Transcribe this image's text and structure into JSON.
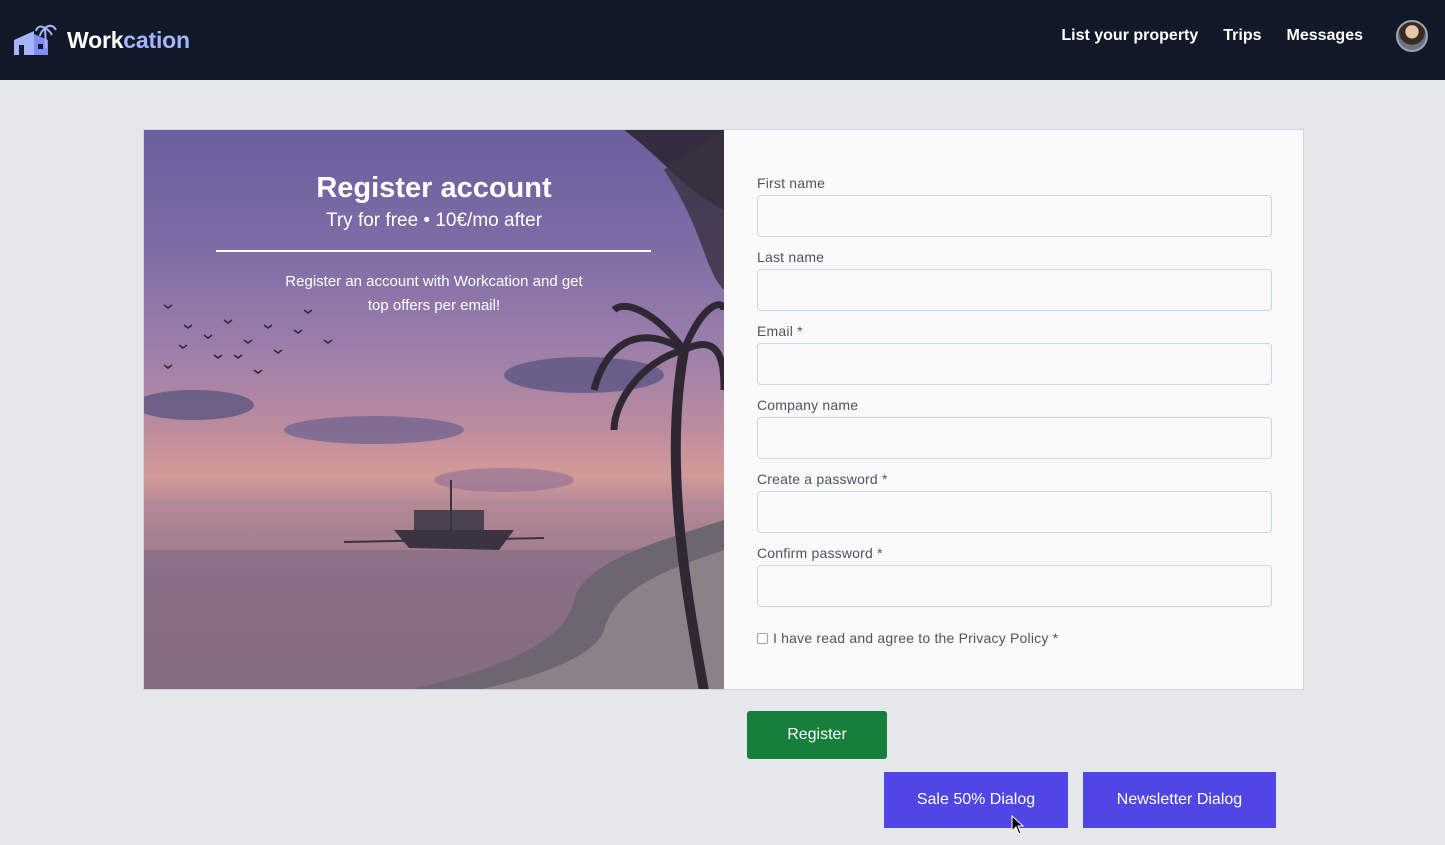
{
  "header": {
    "brand_part1": "Work",
    "brand_part2": "cation",
    "nav": [
      "List your property",
      "Trips",
      "Messages"
    ],
    "logo_icon": "house-palm-logo-icon",
    "avatar_icon": "user-avatar"
  },
  "hero": {
    "title": "Register account",
    "subtitle": "Try for free • 10€/mo after",
    "description": "Register an account with Workcation and get top offers per email!",
    "image": "tropical-beach-sunset-with-boat"
  },
  "form": {
    "fields": [
      {
        "label": "First name",
        "value": ""
      },
      {
        "label": "Last name",
        "value": ""
      },
      {
        "label": "Email *",
        "value": ""
      },
      {
        "label": "Company name",
        "value": ""
      },
      {
        "label": "Create a password *",
        "value": ""
      },
      {
        "label": "Confirm password *",
        "value": ""
      }
    ],
    "privacy_label": "I have read and agree to the Privacy Policy *",
    "privacy_checked": false
  },
  "buttons": {
    "register": "Register",
    "sale": "Sale 50% Dialog",
    "newsletter": "Newsletter Dialog"
  },
  "colors": {
    "header_bg": "#111827",
    "brand_accent": "#a5b4fc",
    "register_green": "#157f3b",
    "dialog_indigo": "#4f46e5",
    "page_bg": "#e5e7eb"
  }
}
